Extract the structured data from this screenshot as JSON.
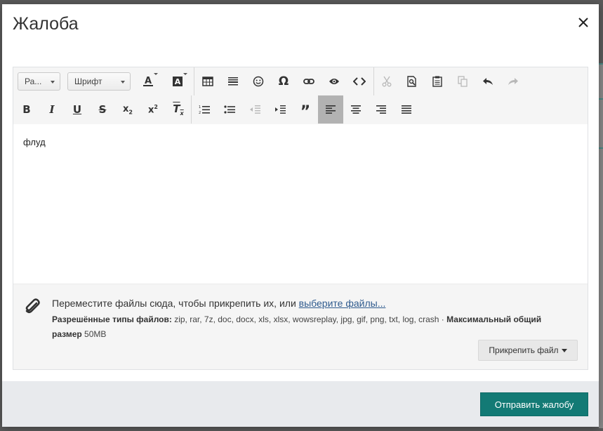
{
  "modal": {
    "title": "Жалоба",
    "close_label": "×"
  },
  "toolbar": {
    "paragraph_select": "Ра...",
    "font_select": "Шрифт",
    "row1": [
      "text-color",
      "background-color",
      "insert-table",
      "horizontal-line",
      "smilies",
      "special-characters",
      "insert-link",
      "preview",
      "source-code",
      "cut",
      "find",
      "paste",
      "copy",
      "undo",
      "redo"
    ],
    "row2": [
      "bold",
      "italic",
      "underline",
      "strikethrough",
      "subscript",
      "superscript",
      "clear-formatting",
      "ordered-list",
      "unordered-list",
      "outdent",
      "indent",
      "quote",
      "align-left",
      "align-center",
      "align-right",
      "justify"
    ],
    "active": "align-left"
  },
  "editor": {
    "content": "флуд"
  },
  "attachments": {
    "prompt_text": "Переместите файлы сюда, чтобы прикрепить их, или ",
    "prompt_link": "выберите файлы...",
    "allowed_label": "Разрешённые типы файлов:",
    "allowed_types": " zip, rar, 7z, doc, docx, xls, xlsx, wowsreplay, jpg, gif, png, txt, log, crash · ",
    "max_size_label": "Максимальный общий размер",
    "max_size_value": " 50MB",
    "attach_button": "Прикрепить файл"
  },
  "footer": {
    "submit_button": "Отправить жалобу"
  },
  "colors": {
    "accent": "#137a75",
    "link": "#2f5b8e",
    "active_toolbar": "#b2b2b2"
  }
}
